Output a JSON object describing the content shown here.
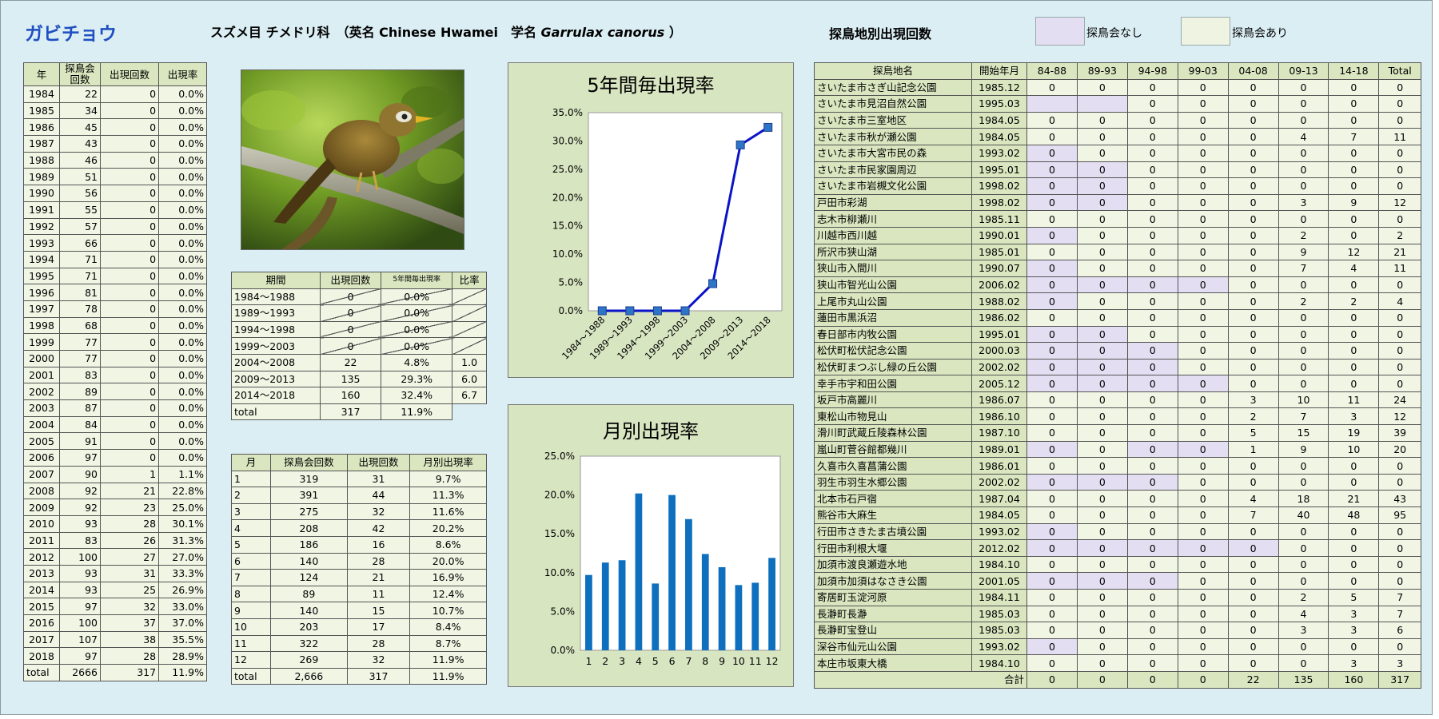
{
  "header": {
    "title": "ガビチョウ",
    "order_family": "スズメ目 チメドリ科",
    "english_prefix": "（英名 Chinese Hwamei",
    "latin_prefix": "学名 ",
    "latin_name": "Garrulax canorus",
    "latin_suffix": " ）",
    "site_section_title": "探鳥地別出現回数",
    "legend_none": "探鳥会なし",
    "legend_held": "探鳥会あり",
    "legend_none_color": "#e4def2",
    "legend_held_color": "#eef3e2"
  },
  "year_table": {
    "headers": [
      "年",
      "探鳥会回数",
      "出現回数",
      "出現率"
    ],
    "rows": [
      [
        "1984",
        "22",
        "0",
        "0.0%"
      ],
      [
        "1985",
        "34",
        "0",
        "0.0%"
      ],
      [
        "1986",
        "45",
        "0",
        "0.0%"
      ],
      [
        "1987",
        "43",
        "0",
        "0.0%"
      ],
      [
        "1988",
        "46",
        "0",
        "0.0%"
      ],
      [
        "1989",
        "51",
        "0",
        "0.0%"
      ],
      [
        "1990",
        "56",
        "0",
        "0.0%"
      ],
      [
        "1991",
        "55",
        "0",
        "0.0%"
      ],
      [
        "1992",
        "57",
        "0",
        "0.0%"
      ],
      [
        "1993",
        "66",
        "0",
        "0.0%"
      ],
      [
        "1994",
        "71",
        "0",
        "0.0%"
      ],
      [
        "1995",
        "71",
        "0",
        "0.0%"
      ],
      [
        "1996",
        "81",
        "0",
        "0.0%"
      ],
      [
        "1997",
        "78",
        "0",
        "0.0%"
      ],
      [
        "1998",
        "68",
        "0",
        "0.0%"
      ],
      [
        "1999",
        "77",
        "0",
        "0.0%"
      ],
      [
        "2000",
        "77",
        "0",
        "0.0%"
      ],
      [
        "2001",
        "83",
        "0",
        "0.0%"
      ],
      [
        "2002",
        "89",
        "0",
        "0.0%"
      ],
      [
        "2003",
        "87",
        "0",
        "0.0%"
      ],
      [
        "2004",
        "84",
        "0",
        "0.0%"
      ],
      [
        "2005",
        "91",
        "0",
        "0.0%"
      ],
      [
        "2006",
        "97",
        "0",
        "0.0%"
      ],
      [
        "2007",
        "90",
        "1",
        "1.1%"
      ],
      [
        "2008",
        "92",
        "21",
        "22.8%"
      ],
      [
        "2009",
        "92",
        "23",
        "25.0%"
      ],
      [
        "2010",
        "93",
        "28",
        "30.1%"
      ],
      [
        "2011",
        "83",
        "26",
        "31.3%"
      ],
      [
        "2012",
        "100",
        "27",
        "27.0%"
      ],
      [
        "2013",
        "93",
        "31",
        "33.3%"
      ],
      [
        "2014",
        "93",
        "25",
        "26.9%"
      ],
      [
        "2015",
        "97",
        "32",
        "33.0%"
      ],
      [
        "2016",
        "100",
        "37",
        "37.0%"
      ],
      [
        "2017",
        "107",
        "38",
        "35.5%"
      ],
      [
        "2018",
        "97",
        "28",
        "28.9%"
      ],
      [
        "total",
        "2666",
        "317",
        "11.9%"
      ]
    ]
  },
  "period_table": {
    "headers": [
      "期間",
      "出現回数",
      "5年間毎出現率",
      "比率"
    ],
    "rows": [
      {
        "period": "1984～1988",
        "count": "0",
        "rate": "0.0%",
        "ratio": "",
        "struck": true
      },
      {
        "period": "1989～1993",
        "count": "0",
        "rate": "0.0%",
        "ratio": "",
        "struck": true
      },
      {
        "period": "1994～1998",
        "count": "0",
        "rate": "0.0%",
        "ratio": "",
        "struck": true
      },
      {
        "period": "1999～2003",
        "count": "0",
        "rate": "0.0%",
        "ratio": "",
        "struck": true
      },
      {
        "period": "2004～2008",
        "count": "22",
        "rate": "4.8%",
        "ratio": "1.0",
        "struck": false
      },
      {
        "period": "2009～2013",
        "count": "135",
        "rate": "29.3%",
        "ratio": "6.0",
        "struck": false
      },
      {
        "period": "2014～2018",
        "count": "160",
        "rate": "32.4%",
        "ratio": "6.7",
        "struck": false
      }
    ],
    "total": {
      "period": "total",
      "count": "317",
      "rate": "11.9%"
    }
  },
  "month_table": {
    "headers": [
      "月",
      "探鳥会回数",
      "出現回数",
      "月別出現率"
    ],
    "rows": [
      [
        "1",
        "319",
        "31",
        "9.7%"
      ],
      [
        "2",
        "391",
        "44",
        "11.3%"
      ],
      [
        "3",
        "275",
        "32",
        "11.6%"
      ],
      [
        "4",
        "208",
        "42",
        "20.2%"
      ],
      [
        "5",
        "186",
        "16",
        "8.6%"
      ],
      [
        "6",
        "140",
        "28",
        "20.0%"
      ],
      [
        "7",
        "124",
        "21",
        "16.9%"
      ],
      [
        "8",
        "89",
        "11",
        "12.4%"
      ],
      [
        "9",
        "140",
        "15",
        "10.7%"
      ],
      [
        "10",
        "203",
        "17",
        "8.4%"
      ],
      [
        "11",
        "322",
        "28",
        "8.7%"
      ],
      [
        "12",
        "269",
        "32",
        "11.9%"
      ],
      [
        "total",
        "2,666",
        "317",
        "11.9%"
      ]
    ]
  },
  "site_table": {
    "headers": [
      "探鳥地名",
      "開始年月",
      "84-88",
      "89-93",
      "94-98",
      "99-03",
      "04-08",
      "09-13",
      "14-18",
      "Total"
    ],
    "rows": [
      {
        "name": "さいたま市さぎ山記念公園",
        "start": "1985.12",
        "v": [
          "0",
          "0",
          "0",
          "0",
          "0",
          "0",
          "0",
          "0"
        ],
        "none": []
      },
      {
        "name": "さいたま市見沼自然公園",
        "start": "1995.03",
        "v": [
          "",
          "",
          "0",
          "0",
          "0",
          "0",
          "0",
          "0"
        ],
        "none": [
          0,
          1
        ]
      },
      {
        "name": "さいたま市三室地区",
        "start": "1984.05",
        "v": [
          "0",
          "0",
          "0",
          "0",
          "0",
          "0",
          "0",
          "0"
        ],
        "none": []
      },
      {
        "name": "さいたま市秋が瀬公園",
        "start": "1984.05",
        "v": [
          "0",
          "0",
          "0",
          "0",
          "0",
          "4",
          "7",
          "11"
        ],
        "none": []
      },
      {
        "name": "さいたま市大宮市民の森",
        "start": "1993.02",
        "v": [
          "0",
          "0",
          "0",
          "0",
          "0",
          "0",
          "0",
          "0"
        ],
        "none": [
          0
        ]
      },
      {
        "name": "さいたま市民家園周辺",
        "start": "1995.01",
        "v": [
          "0",
          "0",
          "0",
          "0",
          "0",
          "0",
          "0",
          "0"
        ],
        "none": [
          0,
          1
        ]
      },
      {
        "name": "さいたま市岩槻文化公園",
        "start": "1998.02",
        "v": [
          "0",
          "0",
          "0",
          "0",
          "0",
          "0",
          "0",
          "0"
        ],
        "none": [
          0,
          1
        ]
      },
      {
        "name": "戸田市彩湖",
        "start": "1998.02",
        "v": [
          "0",
          "0",
          "0",
          "0",
          "0",
          "3",
          "9",
          "12"
        ],
        "none": [
          0,
          1
        ]
      },
      {
        "name": "志木市柳瀬川",
        "start": "1985.11",
        "v": [
          "0",
          "0",
          "0",
          "0",
          "0",
          "0",
          "0",
          "0"
        ],
        "none": []
      },
      {
        "name": "川越市西川越",
        "start": "1990.01",
        "v": [
          "0",
          "0",
          "0",
          "0",
          "0",
          "2",
          "0",
          "2"
        ],
        "none": [
          0
        ]
      },
      {
        "name": "所沢市狭山湖",
        "start": "1985.01",
        "v": [
          "0",
          "0",
          "0",
          "0",
          "0",
          "9",
          "12",
          "21"
        ],
        "none": []
      },
      {
        "name": "狭山市入間川",
        "start": "1990.07",
        "v": [
          "0",
          "0",
          "0",
          "0",
          "0",
          "7",
          "4",
          "11"
        ],
        "none": [
          0
        ]
      },
      {
        "name": "狭山市智光山公園",
        "start": "2006.02",
        "v": [
          "0",
          "0",
          "0",
          "0",
          "0",
          "0",
          "0",
          "0"
        ],
        "none": [
          0,
          1,
          2,
          3
        ]
      },
      {
        "name": "上尾市丸山公園",
        "start": "1988.02",
        "v": [
          "0",
          "0",
          "0",
          "0",
          "0",
          "2",
          "2",
          "4"
        ],
        "none": [
          0
        ]
      },
      {
        "name": "蓮田市黒浜沼",
        "start": "1986.02",
        "v": [
          "0",
          "0",
          "0",
          "0",
          "0",
          "0",
          "0",
          "0"
        ],
        "none": []
      },
      {
        "name": "春日部市内牧公園",
        "start": "1995.01",
        "v": [
          "0",
          "0",
          "0",
          "0",
          "0",
          "0",
          "0",
          "0"
        ],
        "none": [
          0,
          1
        ]
      },
      {
        "name": "松伏町松伏記念公園",
        "start": "2000.03",
        "v": [
          "0",
          "0",
          "0",
          "0",
          "0",
          "0",
          "0",
          "0"
        ],
        "none": [
          0,
          1,
          2
        ]
      },
      {
        "name": "松伏町まつぶし緑の丘公園",
        "start": "2002.02",
        "v": [
          "0",
          "0",
          "0",
          "0",
          "0",
          "0",
          "0",
          "0"
        ],
        "none": [
          0,
          1,
          2
        ]
      },
      {
        "name": "幸手市宇和田公園",
        "start": "2005.12",
        "v": [
          "0",
          "0",
          "0",
          "0",
          "0",
          "0",
          "0",
          "0"
        ],
        "none": [
          0,
          1,
          2,
          3
        ]
      },
      {
        "name": "坂戸市高麗川",
        "start": "1986.07",
        "v": [
          "0",
          "0",
          "0",
          "0",
          "3",
          "10",
          "11",
          "24"
        ],
        "none": []
      },
      {
        "name": "東松山市物見山",
        "start": "1986.10",
        "v": [
          "0",
          "0",
          "0",
          "0",
          "2",
          "7",
          "3",
          "12"
        ],
        "none": []
      },
      {
        "name": "滑川町武蔵丘陵森林公園",
        "start": "1987.10",
        "v": [
          "0",
          "0",
          "0",
          "0",
          "5",
          "15",
          "19",
          "39"
        ],
        "none": []
      },
      {
        "name": "嵐山町菅谷館都幾川",
        "start": "1989.01",
        "v": [
          "0",
          "0",
          "0",
          "0",
          "1",
          "9",
          "10",
          "20"
        ],
        "none": [
          0,
          2,
          3
        ]
      },
      {
        "name": "久喜市久喜菖蒲公園",
        "start": "1986.01",
        "v": [
          "0",
          "0",
          "0",
          "0",
          "0",
          "0",
          "0",
          "0"
        ],
        "none": []
      },
      {
        "name": "羽生市羽生水郷公園",
        "start": "2002.02",
        "v": [
          "0",
          "0",
          "0",
          "0",
          "0",
          "0",
          "0",
          "0"
        ],
        "none": [
          0,
          1,
          2
        ]
      },
      {
        "name": "北本市石戸宿",
        "start": "1987.04",
        "v": [
          "0",
          "0",
          "0",
          "0",
          "4",
          "18",
          "21",
          "43"
        ],
        "none": []
      },
      {
        "name": "熊谷市大麻生",
        "start": "1984.05",
        "v": [
          "0",
          "0",
          "0",
          "0",
          "7",
          "40",
          "48",
          "95"
        ],
        "none": []
      },
      {
        "name": "行田市さきたま古墳公園",
        "start": "1993.02",
        "v": [
          "0",
          "0",
          "0",
          "0",
          "0",
          "0",
          "0",
          "0"
        ],
        "none": [
          0
        ]
      },
      {
        "name": "行田市利根大堰",
        "start": "2012.02",
        "v": [
          "0",
          "0",
          "0",
          "0",
          "0",
          "0",
          "0",
          "0"
        ],
        "none": [
          0,
          1,
          2,
          3,
          4
        ]
      },
      {
        "name": "加須市渡良瀬遊水地",
        "start": "1984.10",
        "v": [
          "0",
          "0",
          "0",
          "0",
          "0",
          "0",
          "0",
          "0"
        ],
        "none": []
      },
      {
        "name": "加須市加須はなさき公園",
        "start": "2001.05",
        "v": [
          "0",
          "0",
          "0",
          "0",
          "0",
          "0",
          "0",
          "0"
        ],
        "none": [
          0,
          1,
          2
        ]
      },
      {
        "name": "寄居町玉淀河原",
        "start": "1984.11",
        "v": [
          "0",
          "0",
          "0",
          "0",
          "0",
          "2",
          "5",
          "7"
        ],
        "none": []
      },
      {
        "name": "長瀞町長瀞",
        "start": "1985.03",
        "v": [
          "0",
          "0",
          "0",
          "0",
          "0",
          "4",
          "3",
          "7"
        ],
        "none": []
      },
      {
        "name": "長瀞町宝登山",
        "start": "1985.03",
        "v": [
          "0",
          "0",
          "0",
          "0",
          "0",
          "3",
          "3",
          "6"
        ],
        "none": []
      },
      {
        "name": "深谷市仙元山公園",
        "start": "1993.02",
        "v": [
          "0",
          "0",
          "0",
          "0",
          "0",
          "0",
          "0",
          "0"
        ],
        "none": [
          0
        ]
      },
      {
        "name": "本庄市坂東大橋",
        "start": "1984.10",
        "v": [
          "0",
          "0",
          "0",
          "0",
          "0",
          "0",
          "3",
          "3"
        ],
        "none": []
      }
    ],
    "total_label": "合計",
    "totals": [
      "0",
      "0",
      "0",
      "0",
      "22",
      "135",
      "160",
      "317"
    ]
  },
  "chart_data": [
    {
      "type": "line",
      "title": "5年間毎出現率",
      "categories": [
        "1984～1988",
        "1989～1993",
        "1994～1998",
        "1999～2003",
        "2004～2008",
        "2009～2013",
        "2014～2018"
      ],
      "values": [
        0.0,
        0.0,
        0.0,
        0.0,
        4.8,
        29.3,
        32.4
      ],
      "yticks": [
        "0.0%",
        "5.0%",
        "10.0%",
        "15.0%",
        "20.0%",
        "25.0%",
        "30.0%",
        "35.0%"
      ],
      "ylim": [
        0,
        35
      ],
      "color": "#0a14c8",
      "marker_color": "#2e75c8",
      "grid": false
    },
    {
      "type": "bar",
      "title": "月別出現率",
      "categories": [
        "1",
        "2",
        "3",
        "4",
        "5",
        "6",
        "7",
        "8",
        "9",
        "10",
        "11",
        "12"
      ],
      "values": [
        9.7,
        11.3,
        11.6,
        20.2,
        8.6,
        20.0,
        16.9,
        12.4,
        10.7,
        8.4,
        8.7,
        11.9
      ],
      "yticks": [
        "0.0%",
        "5.0%",
        "10.0%",
        "15.0%",
        "20.0%",
        "25.0%"
      ],
      "ylim": [
        0,
        25
      ],
      "color": "#0d6fbd",
      "grid": false
    }
  ]
}
